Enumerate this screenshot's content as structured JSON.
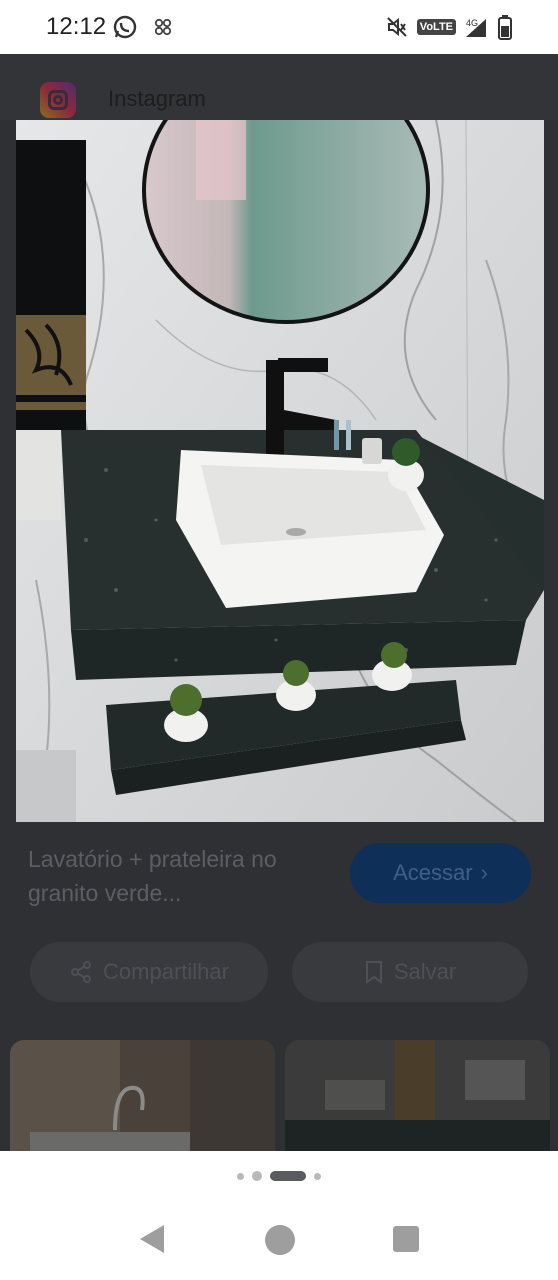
{
  "status_bar": {
    "time": "12:12",
    "network": "4G",
    "volte": "VoLTE"
  },
  "source": {
    "name": "Instagram"
  },
  "result": {
    "title": "Lavatório + prateleira no granito verde...",
    "visit_label": "Acessar",
    "share_label": "Compartilhar",
    "save_label": "Salvar"
  },
  "pager": {
    "count": 4,
    "active_index": 2
  },
  "colors": {
    "overlay": "#2f3033",
    "visit_button": "#0e2f58",
    "granite": "#2a3230"
  }
}
